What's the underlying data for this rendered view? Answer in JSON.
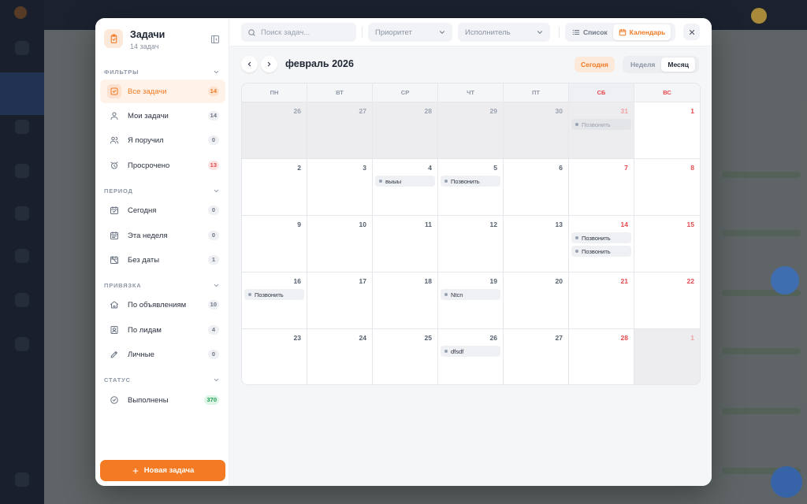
{
  "sidebar": {
    "title": "Задачи",
    "subtitle": "14 задач",
    "sections": {
      "filters": "ФИЛЬТРЫ",
      "period": "ПЕРИОД",
      "binding": "ПРИВЯЗКА",
      "status": "СТАТУС"
    },
    "items": [
      {
        "label": "Все задачи",
        "count": "14",
        "icon": "task-check-icon"
      },
      {
        "label": "Мои задачи",
        "count": "14",
        "icon": "user-icon"
      },
      {
        "label": "Я поручил",
        "count": "0",
        "icon": "users-icon"
      },
      {
        "label": "Просрочено",
        "count": "13",
        "icon": "alarm-icon"
      },
      {
        "label": "Сегодня",
        "count": "0",
        "icon": "calendar-today-icon"
      },
      {
        "label": "Эта неделя",
        "count": "0",
        "icon": "calendar-week-icon"
      },
      {
        "label": "Без даты",
        "count": "1",
        "icon": "calendar-off-icon"
      },
      {
        "label": "По объявлениям",
        "count": "10",
        "icon": "home-icon"
      },
      {
        "label": "По лидам",
        "count": "4",
        "icon": "contact-card-icon"
      },
      {
        "label": "Личные",
        "count": "0",
        "icon": "pencil-icon"
      },
      {
        "label": "Выполнены",
        "count": "370",
        "icon": "check-circle-icon"
      }
    ],
    "new_task_label": "Новая задача"
  },
  "toolbar": {
    "search_placeholder": "Поиск задач...",
    "priority_placeholder": "Приоритет",
    "assignee_placeholder": "Исполнитель",
    "view_list": "Список",
    "view_calendar": "Календарь"
  },
  "calendar": {
    "month_title": "февраль 2026",
    "today_label": "Сегодня",
    "week_label": "Неделя",
    "month_label": "Месяц",
    "weekdays": [
      "ПН",
      "ВТ",
      "СР",
      "ЧТ",
      "ПТ",
      "СБ",
      "ВС"
    ],
    "weeks": [
      [
        {
          "d": "26",
          "muted": true,
          "events": []
        },
        {
          "d": "27",
          "muted": true,
          "events": []
        },
        {
          "d": "28",
          "muted": true,
          "events": []
        },
        {
          "d": "29",
          "muted": true,
          "events": []
        },
        {
          "d": "30",
          "muted": true,
          "events": []
        },
        {
          "d": "31",
          "muted": true,
          "events": [
            "Позвонить"
          ]
        },
        {
          "d": "1",
          "muted": false,
          "events": []
        }
      ],
      [
        {
          "d": "2",
          "events": []
        },
        {
          "d": "3",
          "events": []
        },
        {
          "d": "4",
          "events": [
            "выыы"
          ]
        },
        {
          "d": "5",
          "events": [
            "Позвонить"
          ]
        },
        {
          "d": "6",
          "events": []
        },
        {
          "d": "7",
          "events": []
        },
        {
          "d": "8",
          "events": []
        }
      ],
      [
        {
          "d": "9",
          "events": []
        },
        {
          "d": "10",
          "events": []
        },
        {
          "d": "11",
          "events": []
        },
        {
          "d": "12",
          "events": []
        },
        {
          "d": "13",
          "events": []
        },
        {
          "d": "14",
          "events": [
            "Позвонить",
            "Позвонить"
          ]
        },
        {
          "d": "15",
          "events": []
        }
      ],
      [
        {
          "d": "16",
          "events": [
            "Позвонить"
          ]
        },
        {
          "d": "17",
          "events": []
        },
        {
          "d": "18",
          "events": []
        },
        {
          "d": "19",
          "events": [
            "Ntcn"
          ]
        },
        {
          "d": "20",
          "events": []
        },
        {
          "d": "21",
          "events": []
        },
        {
          "d": "22",
          "events": []
        }
      ],
      [
        {
          "d": "23",
          "events": []
        },
        {
          "d": "24",
          "events": []
        },
        {
          "d": "25",
          "events": []
        },
        {
          "d": "26",
          "events": [
            "dfsdf"
          ]
        },
        {
          "d": "27",
          "events": []
        },
        {
          "d": "28",
          "events": []
        },
        {
          "d": "1",
          "muted": true,
          "events": []
        }
      ]
    ]
  },
  "colors": {
    "accent": "#f47b23",
    "weekend": "#e5484d",
    "overdue_badge": "#e5484d",
    "done_badge": "#1e9e55"
  }
}
